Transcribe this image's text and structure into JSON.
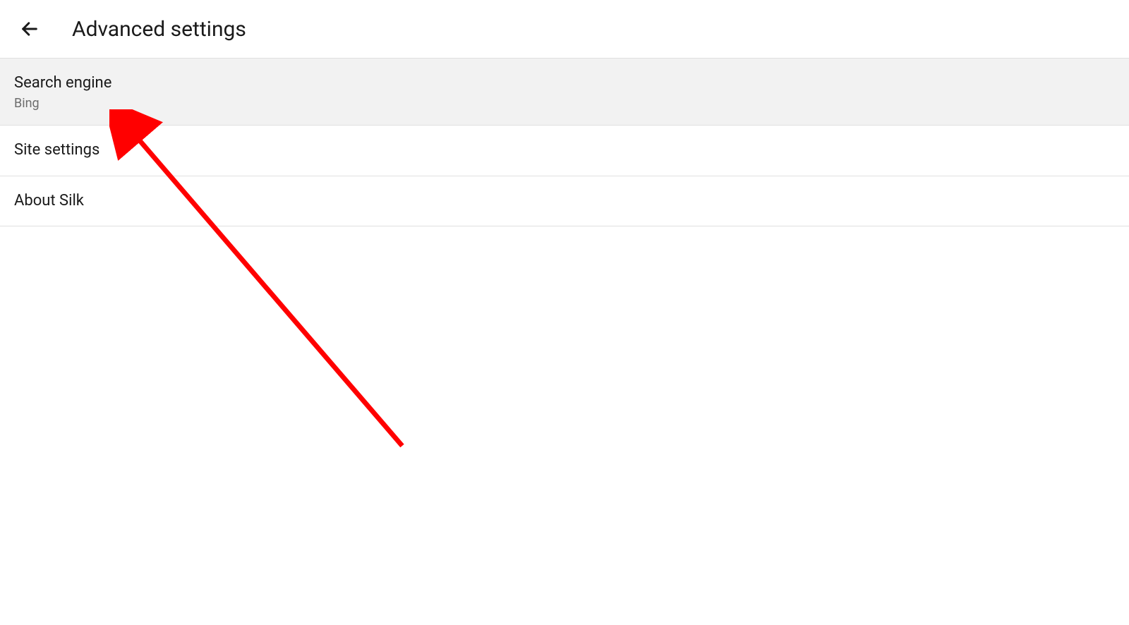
{
  "header": {
    "title": "Advanced settings"
  },
  "settings": [
    {
      "label": "Search engine",
      "value": "Bing",
      "highlighted": true
    },
    {
      "label": "Site settings",
      "value": null,
      "highlighted": false
    },
    {
      "label": "About Silk",
      "value": null,
      "highlighted": false
    }
  ]
}
